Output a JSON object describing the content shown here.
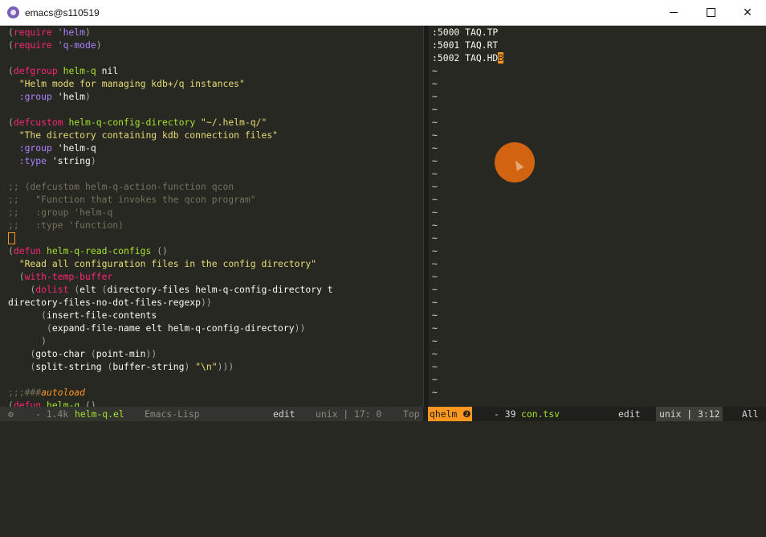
{
  "window": {
    "title": "emacs@s110519"
  },
  "left_lines": [
    "(require 'helm)",
    "(require 'q-mode)",
    "",
    "(defgroup helm-q nil",
    "  \"Helm mode for managing kdb+/q instances\"",
    "  :group 'helm)",
    "",
    "(defcustom helm-q-config-directory \"~/.helm-q/\"",
    "  \"The directory containing kdb connection files\"",
    "  :group 'helm-q",
    "  :type 'string)",
    "",
    ";; (defcustom helm-q-action-function qcon",
    ";;   \"Function that invokes the qcon program\"",
    ";;   :group 'helm-q",
    ";;   :type 'function)",
    "",
    "(defun helm-q-read-configs ()",
    "  \"Read all configuration files in the config directory\"",
    "  (with-temp-buffer",
    "    (dolist (elt (directory-files helm-q-config-directory t",
    "directory-files-no-dot-files-regexp))",
    "      (insert-file-contents",
    "       (expand-file-name elt helm-q-config-directory))",
    "      )",
    "    (goto-char (point-min))",
    "    (split-string (buffer-string) \"\\n\")))",
    "",
    ";;;###autoload",
    "(defun helm-q ()"
  ],
  "right_entries": [
    ":5000 TAQ.TP",
    ":5001 TAQ.RT",
    ":5002 TAQ.HDB"
  ],
  "right_tilde": "~",
  "modeline_left": {
    "icon": "⚙",
    "size": "- 1.4k",
    "buffer": "helm-q.el",
    "mode": "Emacs-Lisp",
    "state": "edit",
    "coding": "unix | 17: 0",
    "position": "Top"
  },
  "modeline_right": {
    "badge": "qhelm ❷",
    "size": "- 39",
    "buffer": "con.tsv",
    "state": "edit",
    "coding": "unix | 3:12",
    "position": "All"
  },
  "colors": {
    "orange": "#fd971f",
    "green": "#a6e22e",
    "background": "#272822"
  }
}
